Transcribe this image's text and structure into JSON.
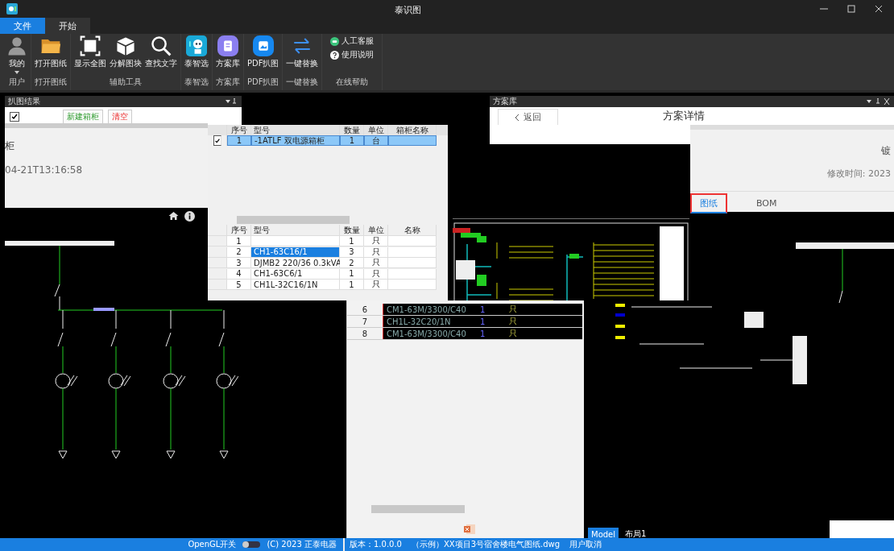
{
  "window": {
    "title": "泰识图"
  },
  "ribbon_tabs": [
    {
      "label": "文件",
      "kind": "file",
      "selected": false
    },
    {
      "label": "开始",
      "kind": "tab",
      "selected": true
    }
  ],
  "ribbon_groups": [
    {
      "label": "用户",
      "buttons": [
        {
          "label": "我的",
          "kind": "user",
          "dropdown": true
        }
      ]
    },
    {
      "label": "打开图纸",
      "buttons": [
        {
          "label": "打开图纸",
          "kind": "folder",
          "dropdown": false
        }
      ]
    },
    {
      "label": "辅助工具",
      "buttons": [
        {
          "label": "显示全图",
          "kind": "extent",
          "dropdown": false
        },
        {
          "label": "分解图块",
          "kind": "cube",
          "dropdown": false
        },
        {
          "label": "查找文字",
          "kind": "search",
          "dropdown": false
        }
      ]
    },
    {
      "label": "泰智选",
      "buttons": [
        {
          "label": "泰智选",
          "kind": "robot",
          "dropdown": false
        }
      ]
    },
    {
      "label": "方案库",
      "buttons": [
        {
          "label": "方案库",
          "kind": "doc",
          "dropdown": false
        }
      ]
    },
    {
      "label": "PDF扒图",
      "buttons": [
        {
          "label": "PDF扒图",
          "kind": "image",
          "dropdown": false
        }
      ]
    },
    {
      "label": "一键替换",
      "buttons": [
        {
          "label": "一键替换",
          "kind": "swap",
          "dropdown": false
        }
      ]
    },
    {
      "label": "在线帮助",
      "links": [
        {
          "label": "人工客服",
          "kind": "chat"
        },
        {
          "label": "使用说明",
          "kind": "help"
        }
      ]
    }
  ],
  "result_panel": {
    "title": "扒图结果",
    "checked": true,
    "buttons": [
      {
        "label": "新建箱柜",
        "kind": "create"
      },
      {
        "label": "清空",
        "kind": "clear"
      }
    ]
  },
  "detail_pane": {
    "name": "柜",
    "time": "04-21T13:16:58"
  },
  "top_table": {
    "columns": [
      "序号",
      "型号",
      "数量",
      "单位",
      "箱柜名称"
    ],
    "rows": [
      {
        "checked": true,
        "selected": true,
        "cells": [
          "1",
          "-1ATLF 双电源箱柜",
          "1",
          "台",
          ""
        ]
      }
    ]
  },
  "bom_table": {
    "columns": [
      "序号",
      "型号",
      "数量",
      "单位",
      "名称"
    ],
    "rows": [
      {
        "selected": false,
        "cells": [
          "1",
          "",
          "1",
          "只",
          ""
        ]
      },
      {
        "selected": true,
        "cells": [
          "2",
          "CH1-63C16/1",
          "3",
          "只",
          ""
        ]
      },
      {
        "selected": false,
        "cells": [
          "3",
          "DJMB2 220/36 0.3kVA",
          "2",
          "只",
          ""
        ]
      },
      {
        "selected": false,
        "cells": [
          "4",
          "CH1-63C6/1",
          "1",
          "只",
          ""
        ]
      },
      {
        "selected": false,
        "cells": [
          "5",
          "CH1L-32C16/1N",
          "1",
          "只",
          ""
        ]
      }
    ]
  },
  "overlay_rows": [
    {
      "cells": [
        "6",
        "CM1-63M/3300/C40",
        "1",
        "只"
      ]
    },
    {
      "cells": [
        "7",
        "CH1L-32C20/1N",
        "1",
        "只"
      ]
    },
    {
      "cells": [
        "8",
        "CM1-63M/3300/C40",
        "1",
        "只"
      ]
    }
  ],
  "scheme_panel": {
    "title": "方案库",
    "back": "返回",
    "heading": "方案详情"
  },
  "detail_card": {
    "name": "镀",
    "modified": "修改时间: 2023",
    "tabs": [
      {
        "label": "图纸",
        "selected": true
      },
      {
        "label": "BOM",
        "selected": false
      }
    ]
  },
  "cad_tabs": [
    {
      "label": "Model",
      "selected": true
    },
    {
      "label": "布局1",
      "selected": false
    }
  ],
  "status_bar": {
    "opengl_label": "OpenGL开关",
    "opengl_on": false,
    "copyright": "(C) 2023 正泰电器",
    "version": "版本：1.0.0.0",
    "file": "（示例）XX项目3号宿舍楼电气图纸.dwg",
    "message": "用户取消"
  }
}
